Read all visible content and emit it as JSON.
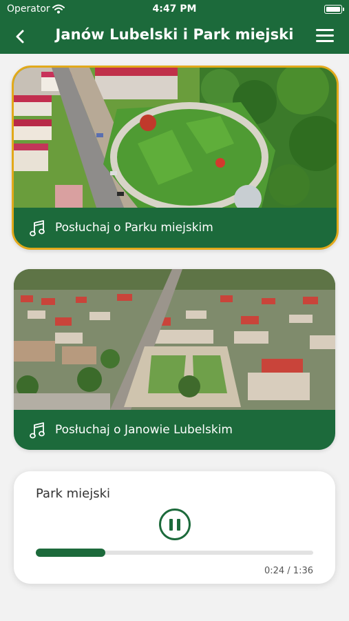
{
  "status_bar": {
    "carrier": "Operator",
    "time": "4:47 PM",
    "icons": [
      "wifi-icon",
      "battery-icon"
    ]
  },
  "nav": {
    "title": "Janów Lubelski i Park miejski",
    "back_icon": "chevron-left-icon",
    "menu_icon": "hamburger-menu-icon"
  },
  "cards": [
    {
      "label": "Posłuchaj o Parku miejskim",
      "icon": "music-note-icon",
      "image": "aerial view of city park with green lawns and paths",
      "selected": true
    },
    {
      "label": "Posłuchaj o Janowie Lubelskim",
      "icon": "music-note-icon",
      "image": "aerial view of Janów Lubelski town square",
      "selected": false
    }
  ],
  "player": {
    "title": "Park miejski",
    "elapsed_label": "0:24 / 1:36",
    "progress_fraction": 0.25,
    "button_icon": "pause-icon"
  },
  "colors": {
    "brand_green": "#1c6a3b",
    "selected_border": "#e2a91a",
    "background": "#f2f2f2"
  }
}
